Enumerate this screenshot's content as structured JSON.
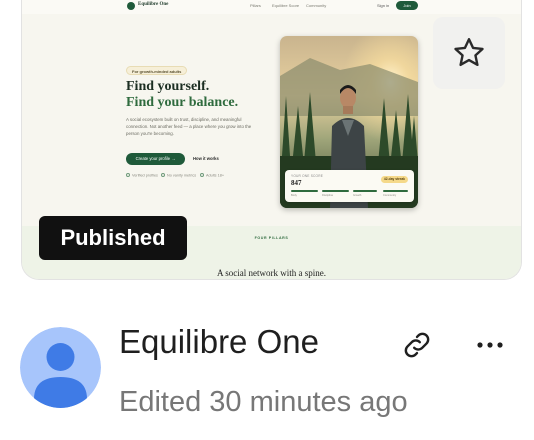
{
  "card": {
    "status_badge": "Published",
    "star_icon": "star-outline-icon",
    "preview": {
      "brand": "Equilibre One",
      "nav_links": [
        "Pillars",
        "Equilibre Score",
        "Community"
      ],
      "sign_in": "Sign in",
      "join": "Join",
      "badge": "For growth-minded adults",
      "title_line1": "Find yourself.",
      "title_line2": "Find your balance.",
      "body": "A social ecosystem built on trust, discipline, and meaningful connection. Not another feed — a place where you grow into the person you're becoming.",
      "cta": "Create your profile →",
      "secondary": "How it works",
      "trust": [
        "Verified profiles",
        "No vanity metrics",
        "Adults 18+"
      ],
      "score_label": "YOUR ONE SCORE",
      "score_value": "847",
      "streak": "42-day streak",
      "pillars": [
        "Body",
        "Discipline",
        "Growth",
        "Community"
      ],
      "section_kicker": "FOUR PILLARS",
      "section_title": "A social network with a spine.",
      "colors": {
        "brand_green": "#1f5a3a",
        "accent_green": "#2f6b3e",
        "cream": "#f7f6ef",
        "streak_gold": "#f5d98a"
      }
    }
  },
  "project": {
    "name": "Equilibre One",
    "edited": "Edited 30 minutes ago",
    "avatar_icon": "user-avatar-icon",
    "actions": [
      "link-icon",
      "more-horizontal-icon"
    ],
    "avatar_colors": {
      "bg": "#a7c5fb",
      "figure": "#3f7be6"
    }
  }
}
